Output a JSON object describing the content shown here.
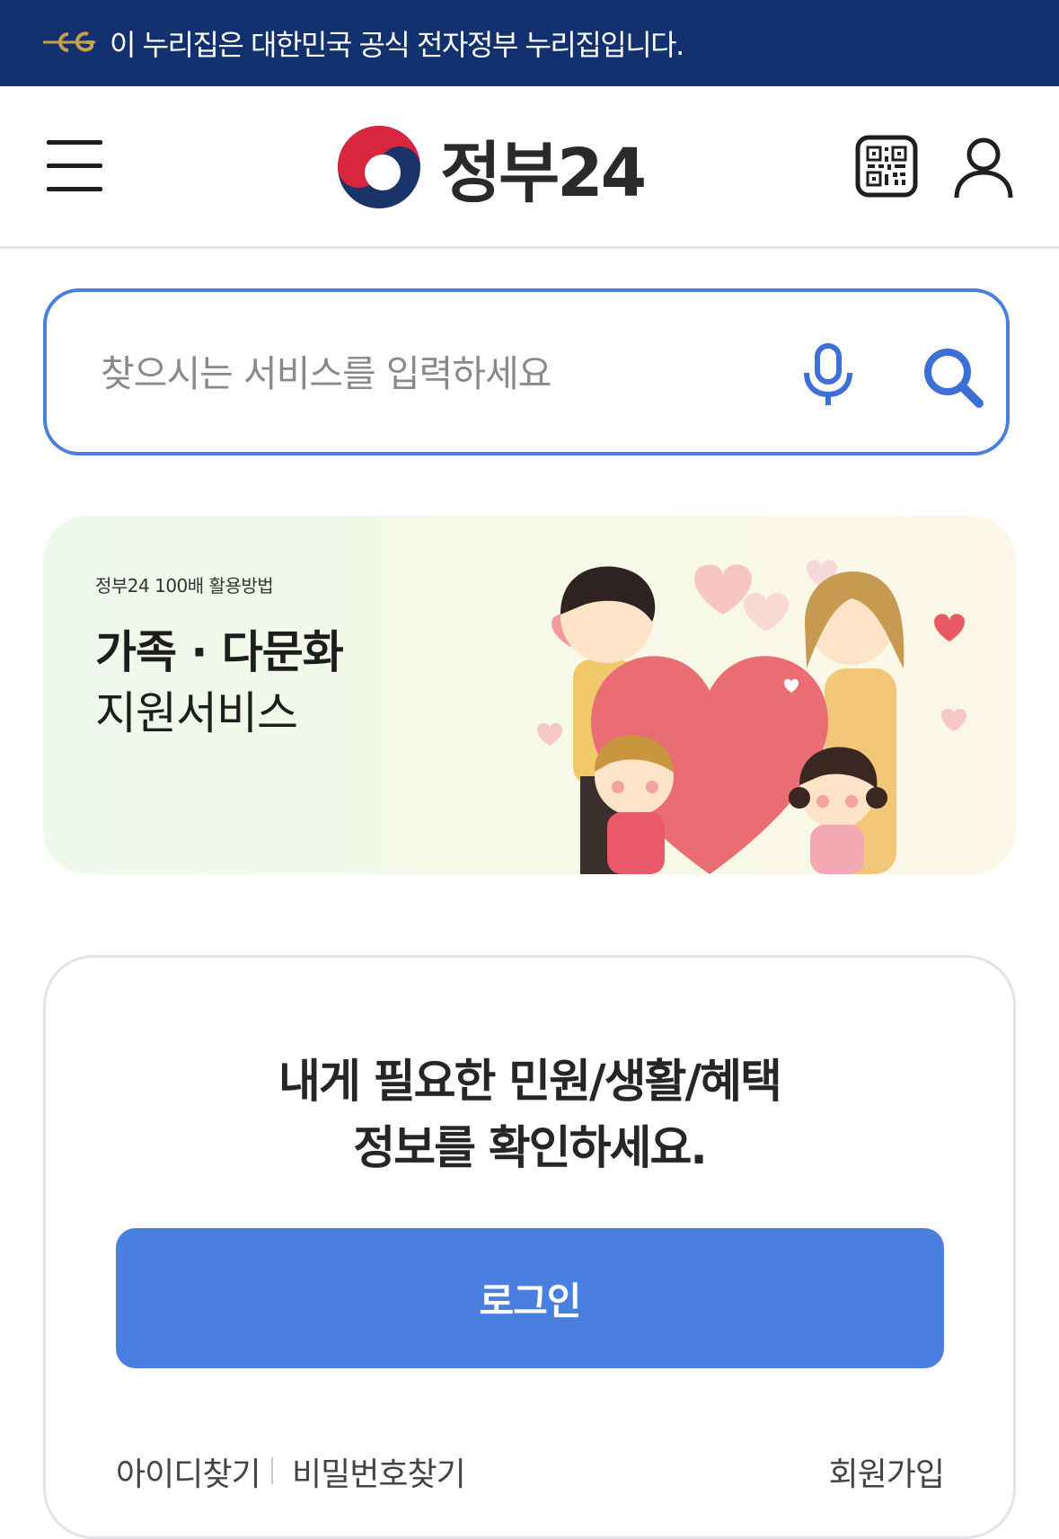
{
  "gov_notice": {
    "text": "이 누리집은 대한민국 공식 전자정부 누리집입니다."
  },
  "header": {
    "logo_text": "정부24"
  },
  "search": {
    "value": "",
    "placeholder": "찾으시는 서비스를 입력하세요"
  },
  "banner": {
    "tag": "정부24 100배 활용방법",
    "title": "가족 · 다문화",
    "subtitle": "지원서비스"
  },
  "login_card": {
    "headline_line1": "내게 필요한 민원/생활/혜택",
    "headline_line2": "정보를 확인하세요.",
    "login_label": "로그인",
    "find_id": "아이디찾기",
    "find_password": "비밀번호찾기",
    "signup": "회원가입"
  },
  "icons": {
    "menu": "hamburger-menu-icon",
    "qr": "qr-code-icon",
    "user": "user-icon",
    "mic": "microphone-icon",
    "search": "search-icon"
  },
  "colors": {
    "gov_strip": "#13306f",
    "accent_blue": "#4a7fe0",
    "logo_red": "#d7263d",
    "logo_navy": "#1a3369"
  }
}
